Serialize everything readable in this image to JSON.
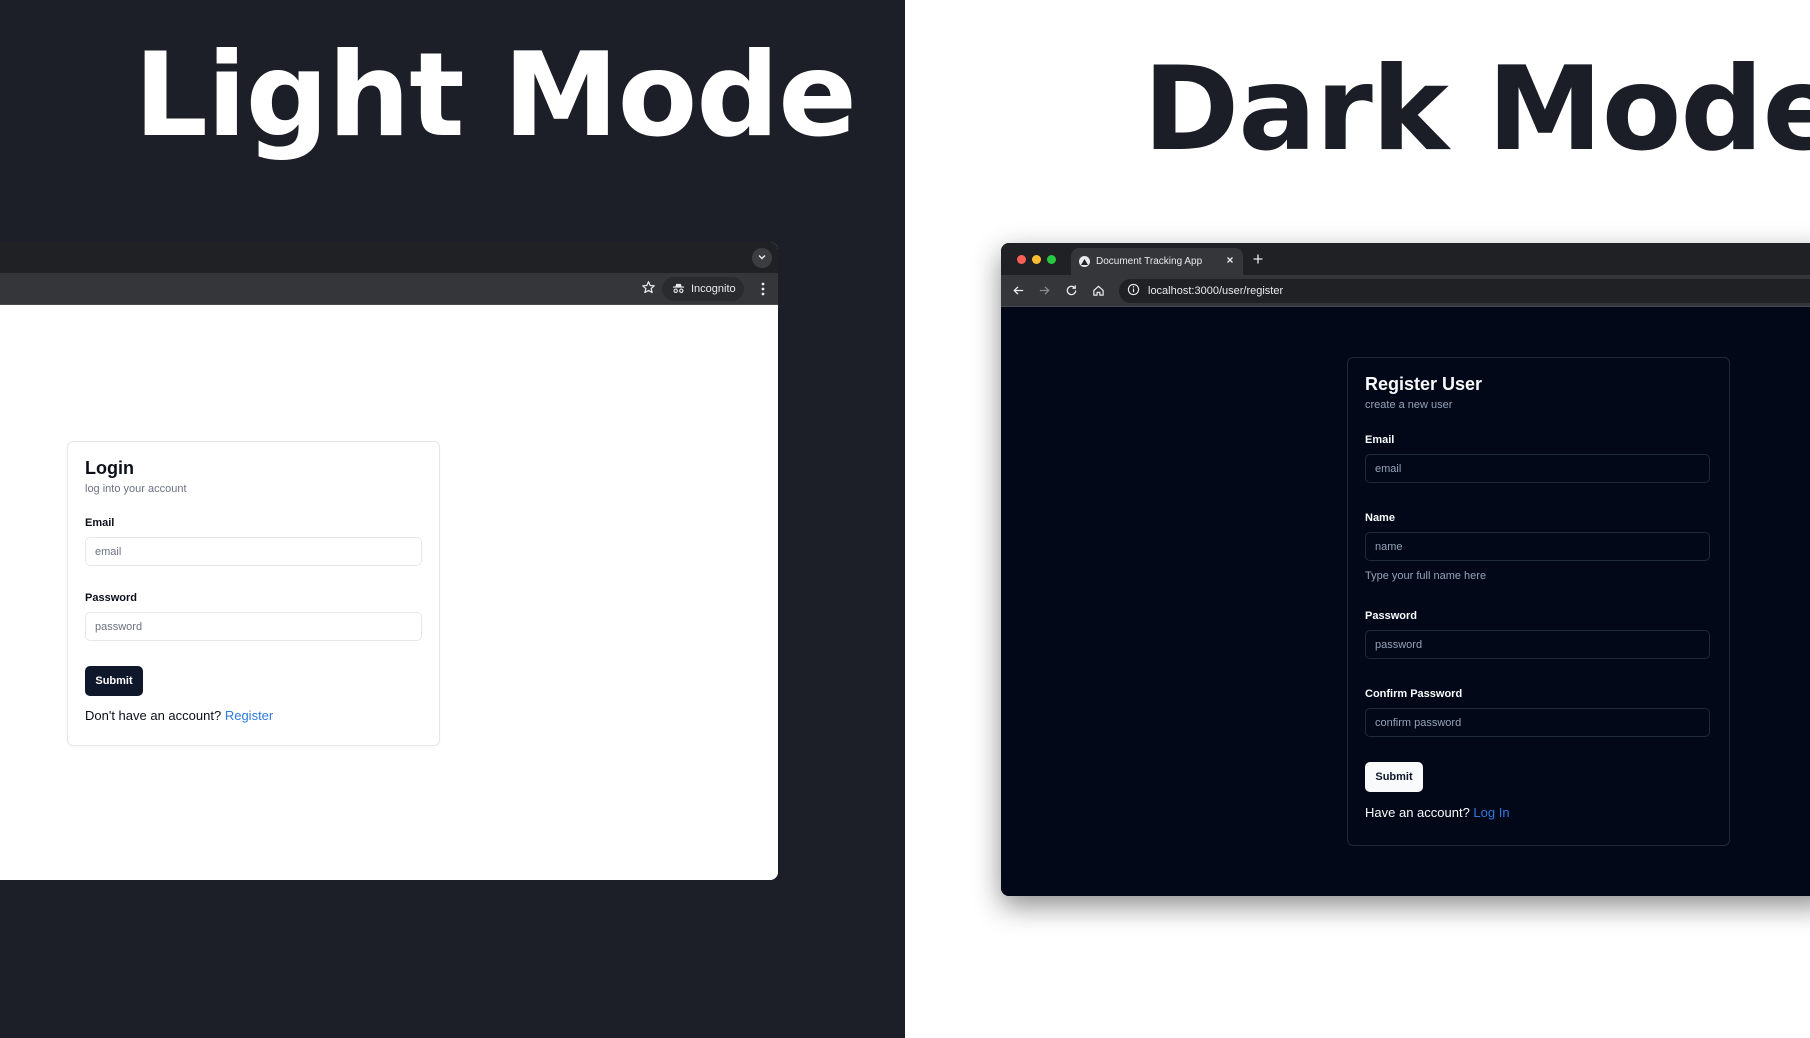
{
  "left": {
    "headline": "Light Mode",
    "browser": {
      "incognito_label": "Incognito"
    },
    "form": {
      "title": "Login",
      "subtitle": "log into your account",
      "email_label": "Email",
      "email_placeholder": "email",
      "password_label": "Password",
      "password_placeholder": "password",
      "submit_label": "Submit",
      "footer_text": "Don't have an account?",
      "footer_link": "Register"
    }
  },
  "right": {
    "headline": "Dark Mode",
    "browser": {
      "tab_title": "Document Tracking App",
      "url": "localhost:3000/user/register"
    },
    "form": {
      "title": "Register User",
      "subtitle": "create a new user",
      "email_label": "Email",
      "email_placeholder": "email",
      "name_label": "Name",
      "name_placeholder": "name",
      "name_hint": "Type your full name here",
      "password_label": "Password",
      "password_placeholder": "password",
      "confirm_label": "Confirm Password",
      "confirm_placeholder": "confirm password",
      "submit_label": "Submit",
      "footer_text": "Have an account?",
      "footer_link": "Log In"
    }
  },
  "colors": {
    "left_bg": "#1c1f27",
    "right_bg": "#ffffff",
    "link": "#2f7ae0",
    "dark_app_bg": "#020817",
    "light_button": "#0f172a"
  },
  "icons": [
    "chevron-down-icon",
    "star-icon",
    "incognito-icon",
    "more-vert-icon",
    "back-icon",
    "forward-icon",
    "reload-icon",
    "home-icon",
    "site-info-icon",
    "close-icon",
    "plus-icon"
  ]
}
